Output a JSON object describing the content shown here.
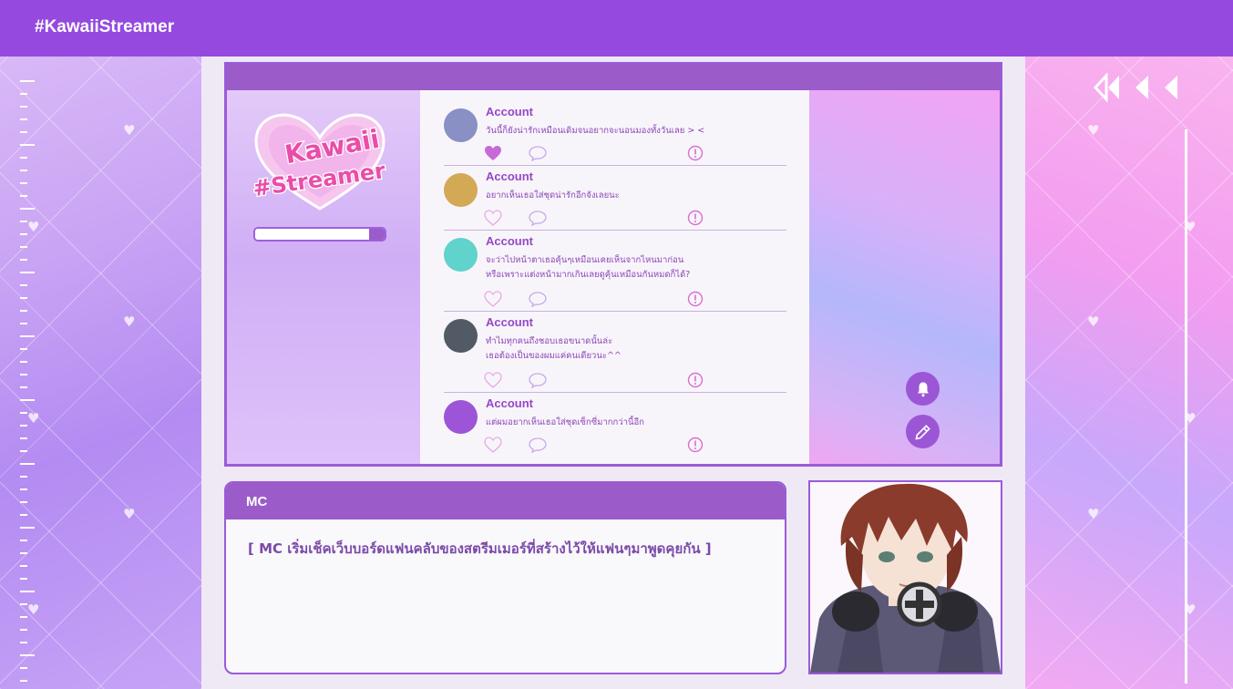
{
  "header": {
    "title": "#KawaiiStreamer"
  },
  "logo": {
    "line1": "Kawaii",
    "line2": "#Streamer"
  },
  "progress": {
    "value": 0.88
  },
  "feed": {
    "posts": [
      {
        "name": "Account",
        "lines": [
          "วันนี้ก็ยังน่ารักเหมือนเดิมจนอยากจะนอนมองทั้งวันเลย > <"
        ],
        "liked": true,
        "avatar_color": "#8890c4"
      },
      {
        "name": "Account",
        "lines": [
          "อยากเห็นเธอใส่ชุดน่ารักอีกจังเลยนะ"
        ],
        "liked": false,
        "avatar_color": "#d4a955"
      },
      {
        "name": "Account",
        "lines": [
          "จะว่าไปหน้าตาเธอคุ้นๆเหมือนเคยเห็นจากไหนมาก่อน",
          "หรือเพราะแต่งหน้ามากเกินเลยดูคุ้นเหมือนกันหมดก็ได้?"
        ],
        "liked": false,
        "avatar_color": "#5fd3cc"
      },
      {
        "name": "Account",
        "lines": [
          "ทำไมทุกคนถึงชอบเธอขนาดนั้นล่ะ",
          "เธอต้องเป็นของผมแค่คนเดียวนะ^^"
        ],
        "liked": false,
        "avatar_color": "#525a66"
      },
      {
        "name": "Account",
        "lines": [
          "แต่ผมอยากเห็นเธอใส่ชุดเซ็กซี่มากกว่านี้อีก"
        ],
        "liked": false,
        "avatar_color": "#9b55d6"
      }
    ]
  },
  "icons": {
    "like": "heart-icon",
    "comment": "speech-bubble-icon",
    "report": "exclamation-circle-icon",
    "bell": "bell-icon",
    "edit": "pencil-icon",
    "nav": [
      "double-rewind-icon",
      "rewind-icon",
      "back-icon"
    ]
  },
  "dialogue": {
    "speaker": "MC",
    "text": "[ MC เริ่มเช็คเว็บบอร์ดแฟนคลับของสตรีมเมอร์ที่สร้างไว้ให้แฟนๆมาพูดคุยกัน ]"
  },
  "colors": {
    "accent": "#9549df",
    "panel": "#9b5cca",
    "text": "#8b45b8"
  }
}
